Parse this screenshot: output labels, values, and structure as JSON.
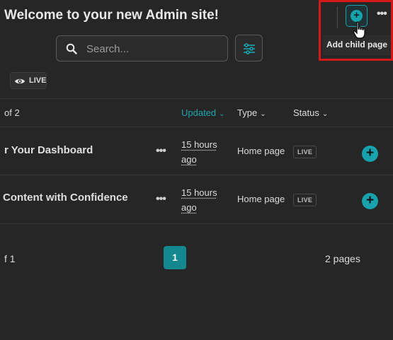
{
  "header": {
    "title": "Welcome to your new Admin site!",
    "more_icon": "more-horizontal-icon"
  },
  "search": {
    "placeholder": "Search...",
    "icon": "search-icon",
    "filter_icon": "sliders-icon"
  },
  "status_pill": {
    "icon": "eye-icon",
    "label": "LIVE"
  },
  "add_child": {
    "icon": "plus-circle-icon",
    "tooltip": "Add child page"
  },
  "table": {
    "count_text": "of 2",
    "columns": {
      "updated": "Updated",
      "type": "Type",
      "status": "Status"
    },
    "rows": [
      {
        "title": "r Your Dashboard",
        "updated_line1": "15 hours",
        "updated_line2": "ago",
        "type": "Home page",
        "status": "LIVE"
      },
      {
        "title": "Content with Confidence",
        "updated_line1": "15 hours",
        "updated_line2": "ago",
        "type": "Home page",
        "status": "LIVE"
      }
    ]
  },
  "pagination": {
    "page_of": "f 1",
    "current_page": "1",
    "total": "2 pages"
  },
  "colors": {
    "accent": "#1ba5b0",
    "highlight": "#d21a1a",
    "background": "#262626"
  }
}
